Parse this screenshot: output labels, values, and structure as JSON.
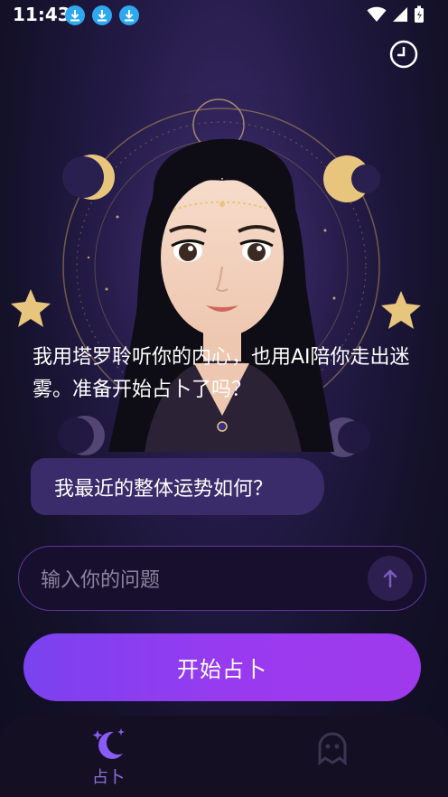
{
  "status_bar": {
    "time": "11:43",
    "notifications": [
      "download-icon",
      "download-icon",
      "download-icon"
    ]
  },
  "header": {
    "history_icon": "clock-icon"
  },
  "message": {
    "text": "我用塔罗聆听你的内心，也用AI陪你走出迷雾。准备开始占卜了吗？"
  },
  "suggestion": {
    "label": "我最近的整体运势如何？"
  },
  "input": {
    "placeholder": "输入你的问题",
    "value": ""
  },
  "start_button": {
    "label": "开始占卜"
  },
  "tabbar": {
    "tabs": [
      {
        "label": "占卜",
        "icon": "moon-stars-icon",
        "active": true
      },
      {
        "label": "",
        "icon": "ghost-icon",
        "active": false
      }
    ]
  },
  "colors": {
    "accent": "#8a5cf6",
    "button_start": "#7a42f0",
    "button_end": "#9e3aec",
    "bubble": "#3a2c6b",
    "gold": "#e8c57c"
  }
}
